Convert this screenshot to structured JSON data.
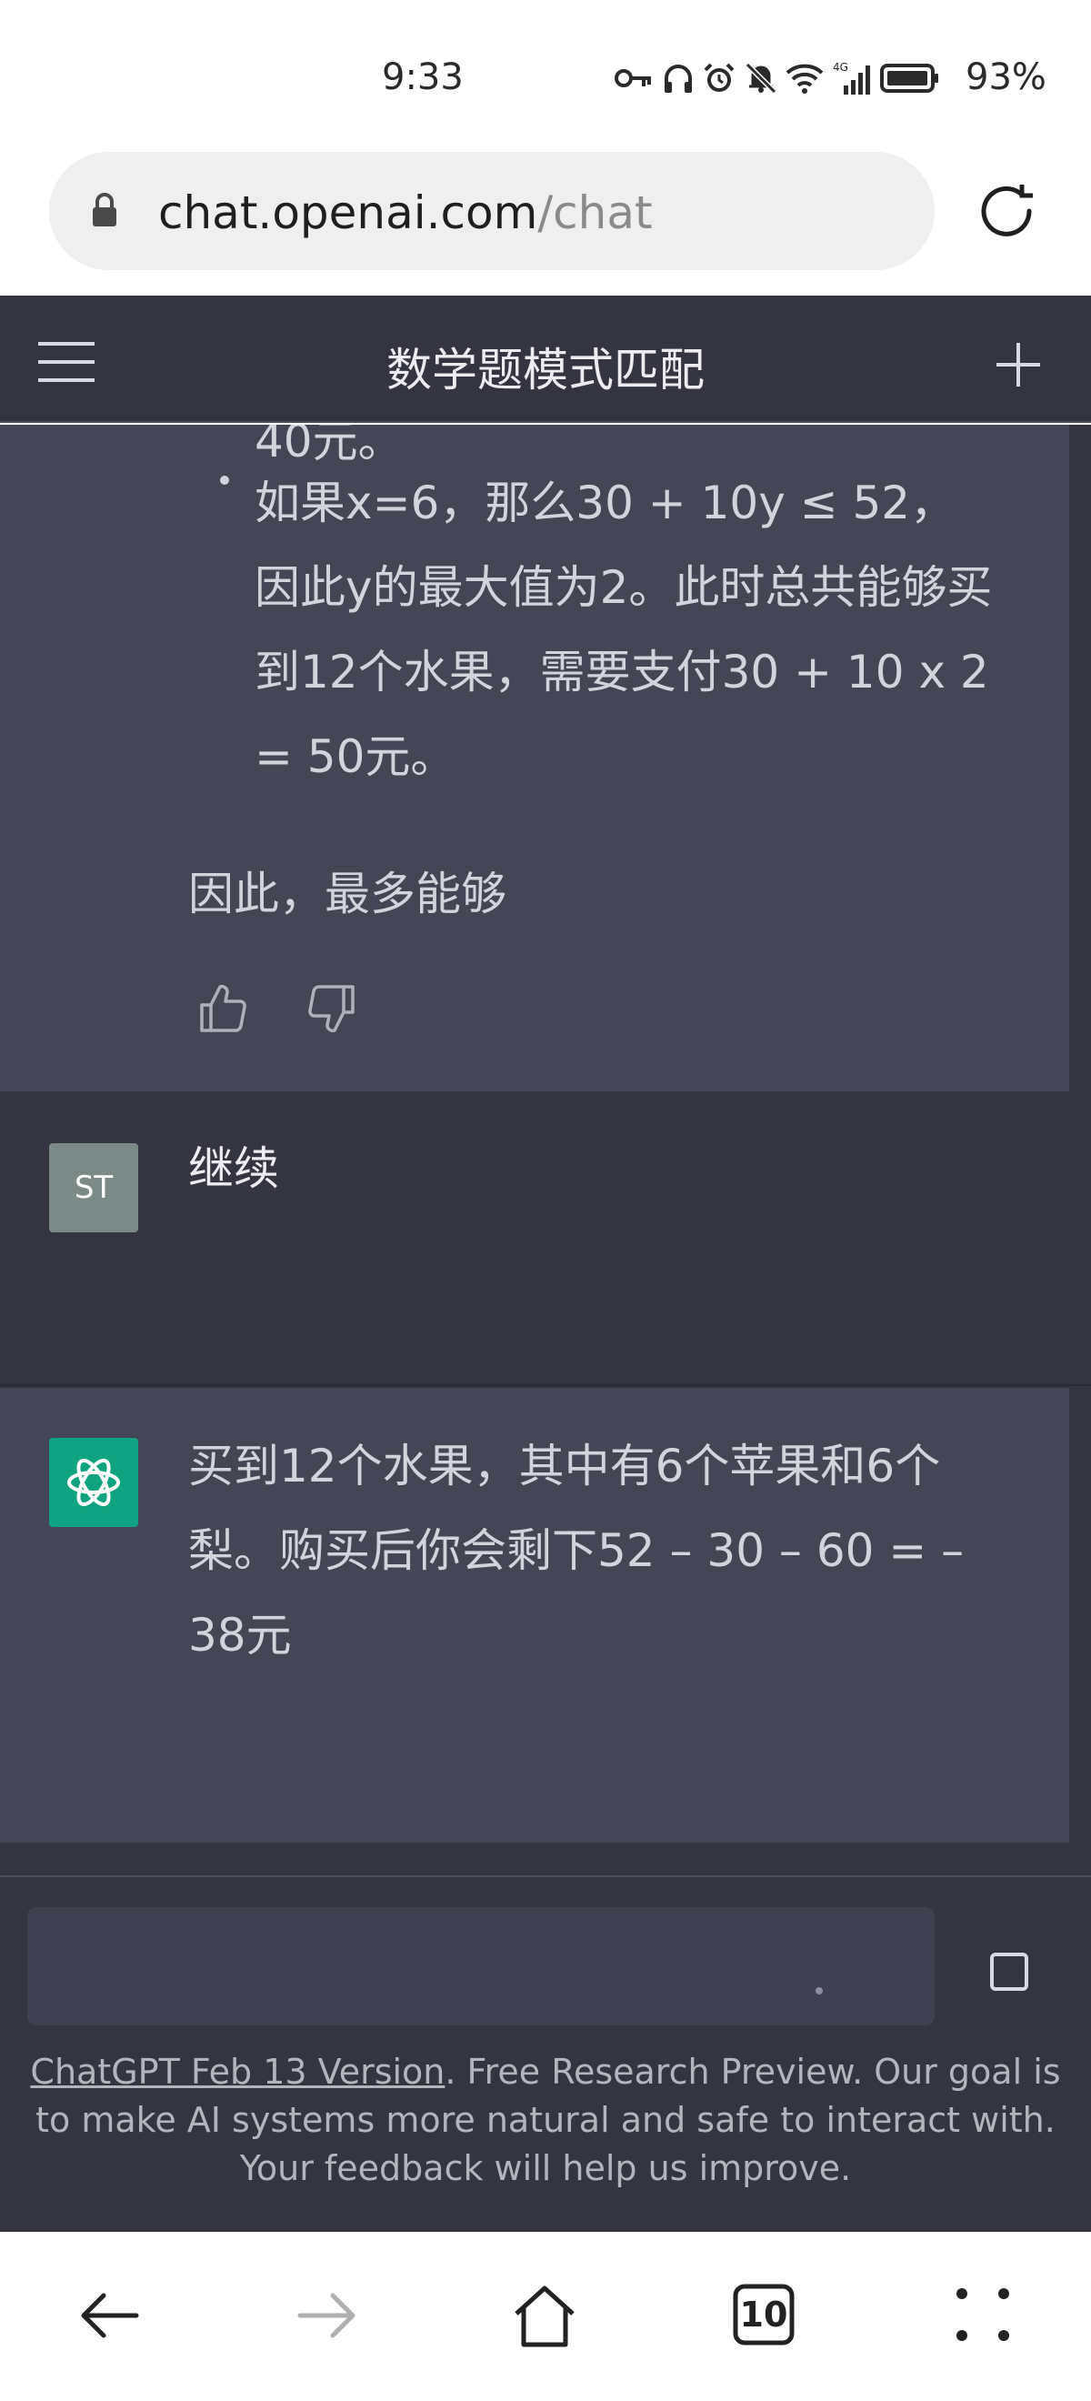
{
  "status_bar": {
    "time": "9:33",
    "battery": "93%"
  },
  "browser": {
    "url_domain": "chat.openai.com",
    "url_path": "/chat",
    "tab_count": "10"
  },
  "header": {
    "title": "数学题模式匹配"
  },
  "conversation": {
    "partial_top_line": "40元。",
    "bullet_item": "如果x=6，那么30 + 10y ≤ 52，因此y的最大值为2。此时总共能够买到12个水果，需要支付30 + 10 x 2 = 50元。",
    "conclusion": "因此，最多能够",
    "user_avatar_initials": "ST",
    "user_message": "继续",
    "assistant_reply": "买到12个水果，其中有6个苹果和6个梨。购买后你会剩下52 – 30 – 60 = –38元"
  },
  "footer": {
    "version_link": "ChatGPT Feb 13 Version",
    "note": ". Free Research Preview. Our goal is to make AI systems more natural and safe to interact with. Your feedback will help us improve."
  },
  "colors": {
    "header_bg": "#343541",
    "assistant_bg": "#444654",
    "gpt_green": "#10a37f",
    "user_avatar": "#7b8a86"
  }
}
